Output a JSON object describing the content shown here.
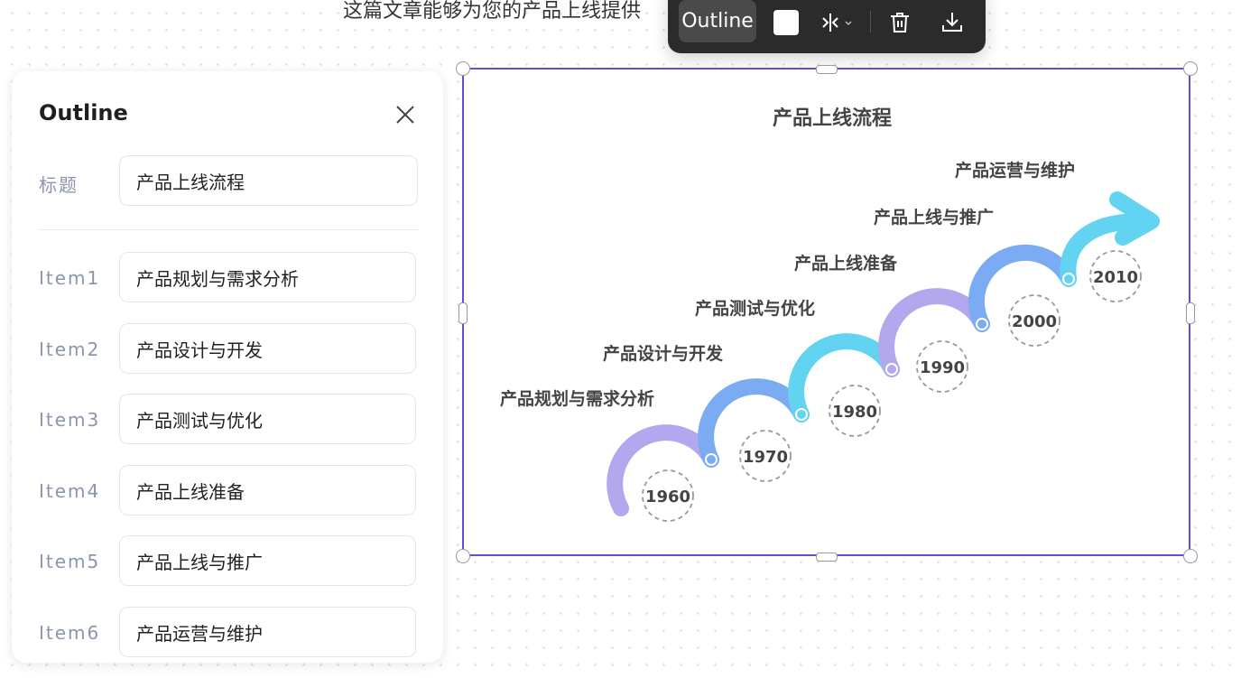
{
  "document": {
    "text": "这篇文章能够为您的产品上线提供"
  },
  "toolbar": {
    "outline_label": "Outline",
    "color": "#ffffff",
    "icons": [
      "square-color-icon",
      "mirror-icon",
      "trash-icon",
      "download-icon"
    ]
  },
  "panel": {
    "title": "Outline",
    "title_label": "标题",
    "title_value": "产品上线流程",
    "items": [
      {
        "label": "Item1",
        "value": "产品规划与需求分析"
      },
      {
        "label": "Item2",
        "value": "产品设计与开发"
      },
      {
        "label": "Item3",
        "value": "产品测试与优化"
      },
      {
        "label": "Item4",
        "value": "产品上线准备"
      },
      {
        "label": "Item5",
        "value": "产品上线与推广"
      },
      {
        "label": "Item6",
        "value": "产品运营与维护"
      }
    ]
  },
  "diagram": {
    "title": "产品上线流程",
    "steps": [
      {
        "label": "产品规划与需求分析",
        "year": "1960",
        "color": "#b3a7ee"
      },
      {
        "label": "产品设计与开发",
        "year": "1970",
        "color": "#7bacf3"
      },
      {
        "label": "产品测试与优化",
        "year": "1980",
        "color": "#62d3f0"
      },
      {
        "label": "产品上线准备",
        "year": "1990",
        "color": "#b3a7ee"
      },
      {
        "label": "产品上线与推广",
        "year": "2000",
        "color": "#7bacf3"
      },
      {
        "label": "产品运营与维护",
        "year": "2010",
        "color": "#62d3f0"
      }
    ]
  },
  "colors": {
    "selection": "#5b4fe0",
    "toolbar_bg": "#2b2b2b"
  }
}
